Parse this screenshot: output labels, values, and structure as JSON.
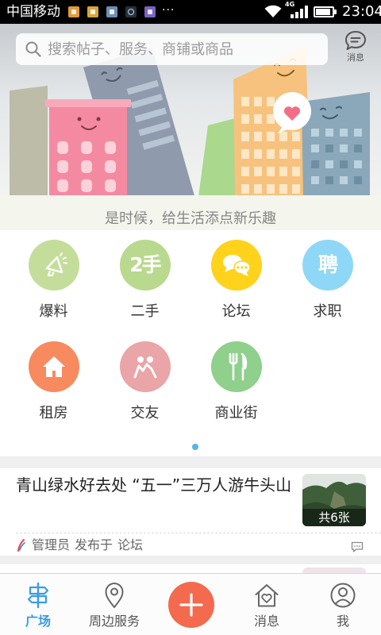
{
  "status_bar": {
    "carrier": "中国移动",
    "notification_icons": [
      "orange-app-notification-icon",
      "lock-app-notification-icon",
      "gallery-app-notification-icon",
      "camera-app-notification-icon",
      "photo-editor-notification-icon"
    ],
    "more_indicator": "···",
    "wifi_icon": "wifi-icon",
    "network_type": "4G",
    "signal_icon": "signal-bars-icon",
    "battery_icon": "battery-icon",
    "battery_level": 0.9,
    "time": "23:04"
  },
  "search": {
    "icon": "search-icon",
    "placeholder": "搜索帖子、服务、商铺或商品"
  },
  "message_shortcut": {
    "icon": "message-bubble-icon",
    "label": "消息"
  },
  "banner": {
    "slogan": "是时候，给生活添点新乐趣"
  },
  "categories": [
    {
      "label": "爆料",
      "icon": "megaphone-icon",
      "color": "#c5dd9b"
    },
    {
      "label": "二手",
      "icon": "second-hand-icon",
      "glyph": "2手",
      "color": "#b9d98f"
    },
    {
      "label": "论坛",
      "icon": "chat-bubbles-icon",
      "color": "#ffd21c"
    },
    {
      "label": "求职",
      "icon": "hiring-icon",
      "glyph": "聘",
      "color": "#8fd7f7"
    },
    {
      "label": "租房",
      "icon": "house-icon",
      "color": "#f78a5f"
    },
    {
      "label": "交友",
      "icon": "friends-icon",
      "color": "#e9a5a7"
    },
    {
      "label": "商业街",
      "icon": "fork-knife-icon",
      "color": "#8ed08c"
    }
  ],
  "pager": {
    "active_color": "#5bb2e8"
  },
  "feed": [
    {
      "title": "青山绿水好去处 “五一”三万人游牛头山",
      "photo_count": "共6张",
      "author_icon": "admin-badge-icon",
      "author": "管理员",
      "action": "发布于",
      "board": "论坛",
      "comment_icon": "comment-icon"
    }
  ],
  "tab_bar": {
    "active_color": "#3a9be6",
    "items": [
      {
        "label": "广场",
        "icon": "plaza-signpost-icon",
        "active": true
      },
      {
        "label": "周边服务",
        "icon": "location-pin-icon",
        "active": false
      },
      {
        "label": "消息",
        "icon": "message-house-icon",
        "active": false
      },
      {
        "label": "我",
        "icon": "profile-icon",
        "active": false
      }
    ],
    "publish_button": {
      "icon": "plus-icon",
      "color": "#f36a4e"
    }
  }
}
